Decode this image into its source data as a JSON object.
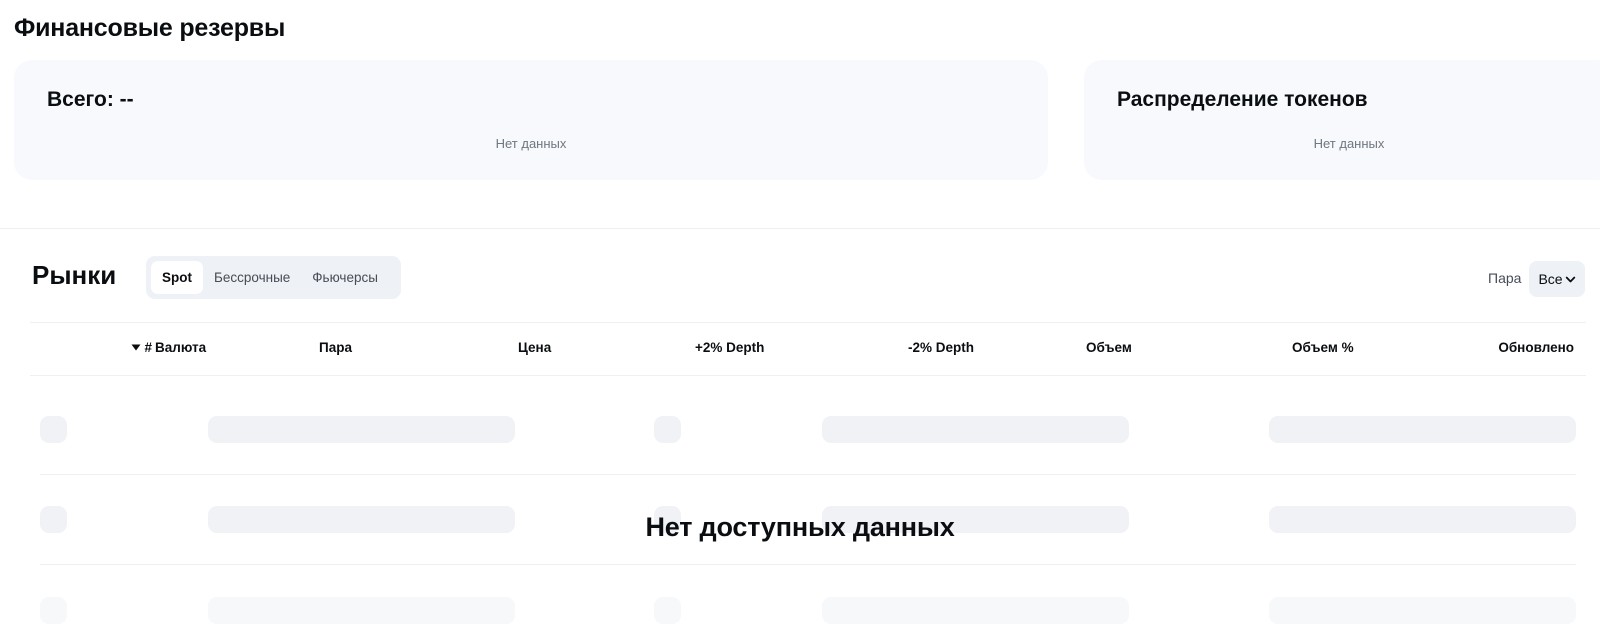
{
  "page": {
    "title": "Финансовые резервы"
  },
  "reserves": {
    "total_label": "Всего: --",
    "total_empty": "Нет данных",
    "distribution_title": "Распределение токенов",
    "distribution_empty": "Нет данных"
  },
  "markets": {
    "title": "Рынки",
    "tabs": [
      {
        "label": "Spot",
        "active": true
      },
      {
        "label": "Бессрочные",
        "active": false
      },
      {
        "label": "Фьючерсы",
        "active": false
      }
    ],
    "pair_filter": {
      "label": "Пара",
      "value": "Все",
      "icon": "chevron-down-icon"
    },
    "sort_icon": "caret-down-icon",
    "columns": {
      "num": "#",
      "currency": "Валюта",
      "pair": "Пара",
      "price": "Цена",
      "depth_plus": "+2% Depth",
      "depth_minus": "-2% Depth",
      "volume": "Объем",
      "volume_pct": "Объем %",
      "updated": "Обновлено"
    },
    "empty_message": "Нет доступных данных"
  },
  "colors": {
    "card_bg": "#f7f9fc",
    "skeleton": "#f0f2f5",
    "text_primary": "#0b0e11",
    "text_secondary": "#6f7780"
  }
}
